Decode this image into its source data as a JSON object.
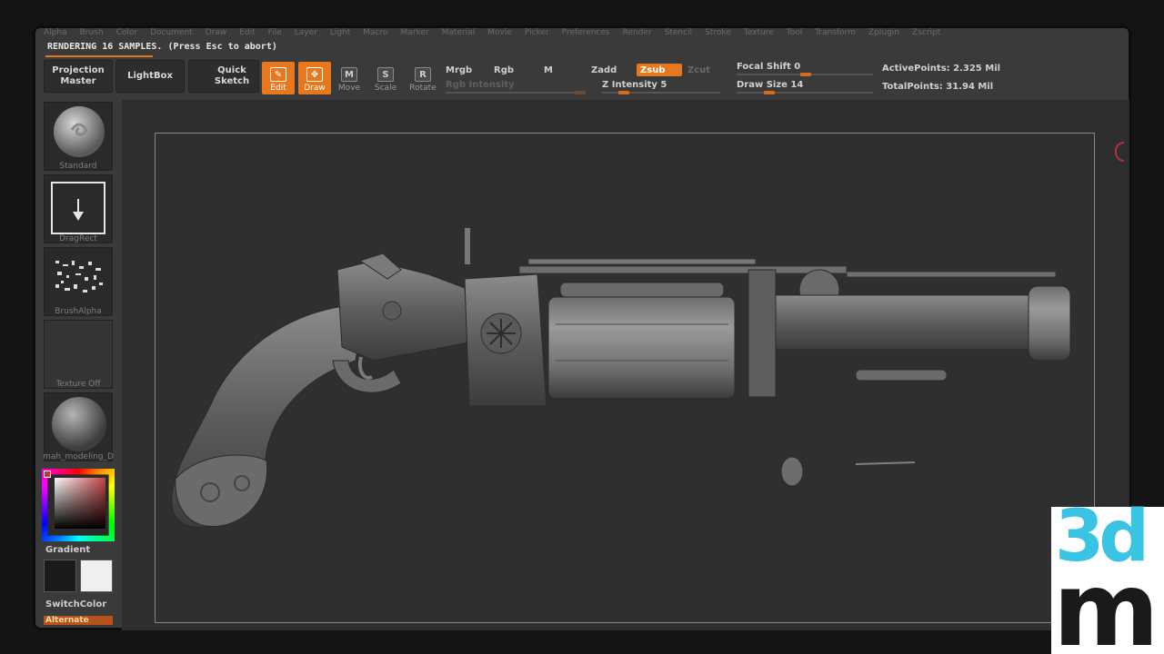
{
  "menu": [
    "Alpha",
    "Brush",
    "Color",
    "Document",
    "Draw",
    "Edit",
    "File",
    "Layer",
    "Light",
    "Macro",
    "Marker",
    "Material",
    "Movie",
    "Picker",
    "Preferences",
    "Render",
    "Stencil",
    "Stroke",
    "Texture",
    "Tool",
    "Transform",
    "Zplugin",
    "Zscript"
  ],
  "status": {
    "rendering": "RENDERING 16 SAMPLES. (Press Esc to abort)"
  },
  "toolbar": {
    "projection_master": "Projection Master",
    "lightbox": "LightBox",
    "quick_sketch": "Quick Sketch",
    "edit": "Edit",
    "draw": "Draw",
    "move": "Move",
    "scale": "Scale",
    "rotate": "Rotate",
    "move_glyph": "M",
    "scale_glyph": "S",
    "rotate_glyph": "R"
  },
  "modes": {
    "mrgb": "Mrgb",
    "rgb": "Rgb",
    "m": "M",
    "zadd": "Zadd",
    "zsub": "Zsub",
    "zcut": "Zcut"
  },
  "sliders": {
    "rgb_intensity": "Rgb Intensity",
    "z_intensity": "Z Intensity 5",
    "focal_shift": "Focal Shift 0",
    "draw_size": "Draw Size 14",
    "z_intensity_value": 5,
    "focal_shift_value": 0,
    "draw_size_value": 14
  },
  "stats": {
    "active_points": "ActivePoints: 2.325 Mil",
    "total_points": "TotalPoints: 31.94 Mil"
  },
  "shelf": {
    "brush": "Standard",
    "stroke": "DragRect",
    "alpha": "BrushAlpha",
    "texture": "Texture Off",
    "material": "mah_modeling_D",
    "gradient": "Gradient",
    "switch_color": "SwitchColor",
    "alternate": "Alternate"
  },
  "colors": {
    "accent": "#e8781e",
    "main_color": "#1a1a1a",
    "secondary_color": "#f0f0f0"
  },
  "logo": {
    "top": "3d",
    "bottom": "m"
  }
}
